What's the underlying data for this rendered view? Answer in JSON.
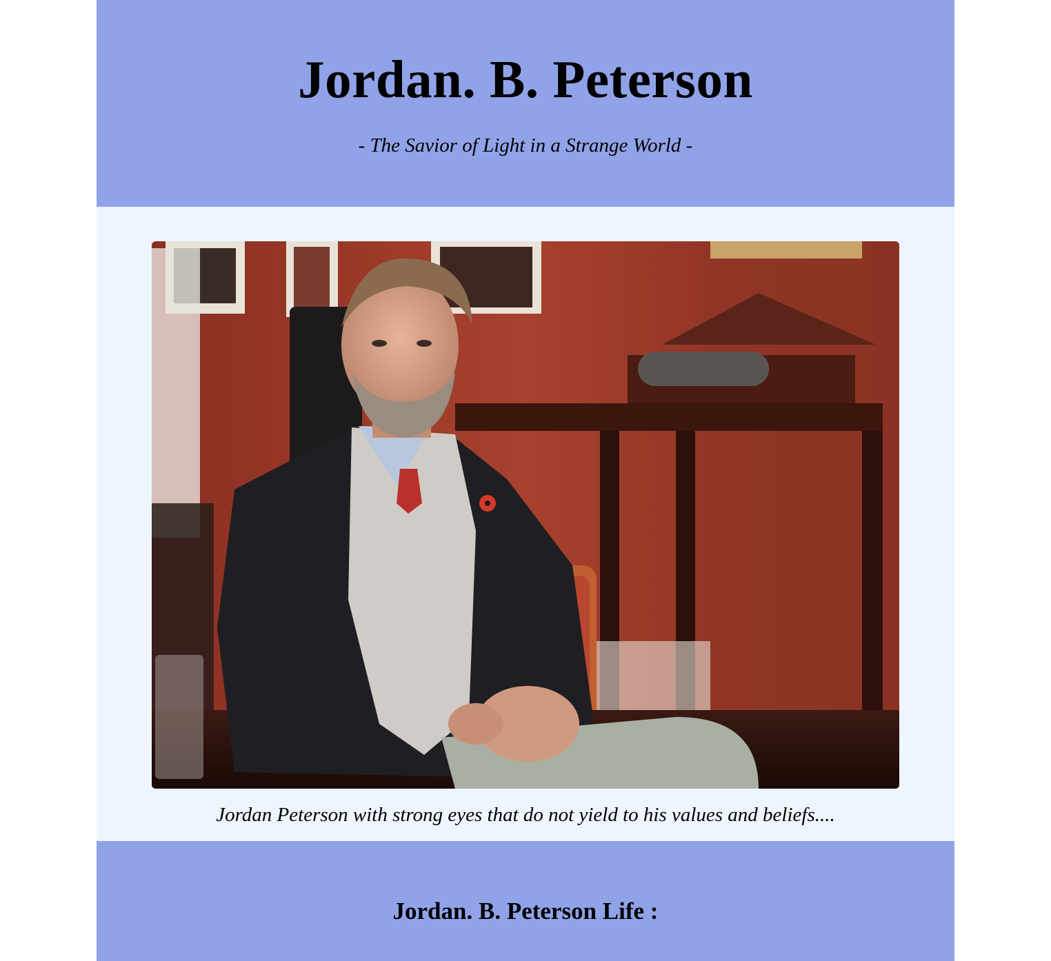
{
  "header": {
    "title": "Jordan. B. Peterson",
    "subtitle": "- The Savior of Light in a Strange World -"
  },
  "main": {
    "photo_alt": "Jordan Peterson seated at a table",
    "caption": "Jordan Peterson with strong eyes that do not yield to his values and beliefs...."
  },
  "footer": {
    "section_heading": "Jordan. B. Peterson Life :"
  },
  "colors": {
    "header_bg": "#91a3e8",
    "main_bg": "#eef5fe",
    "text": "#000000"
  }
}
